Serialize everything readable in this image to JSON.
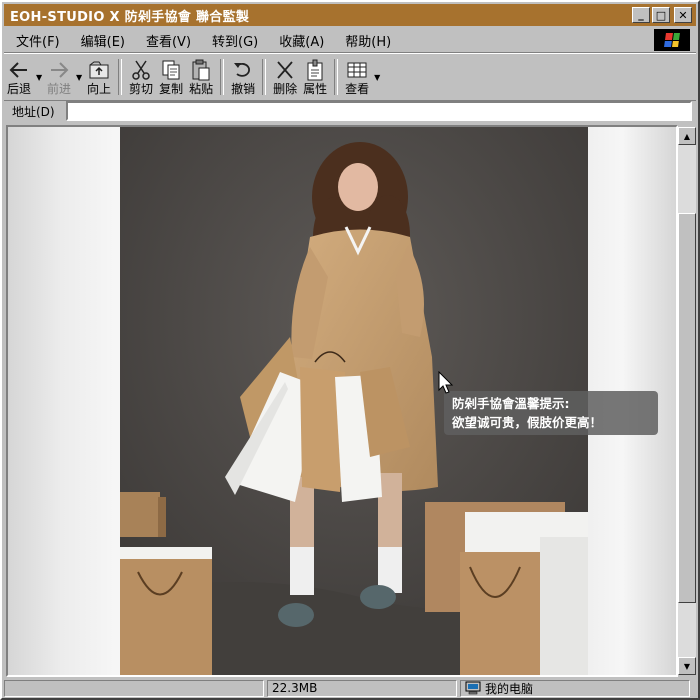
{
  "window": {
    "title": "EOH-STUDIO X 防剁手協會 聯合監製"
  },
  "titlebar_buttons": {
    "minimize": "_",
    "maximize": "□",
    "close": "✕"
  },
  "menu": [
    "文件(F)",
    "编辑(E)",
    "查看(V)",
    "转到(G)",
    "收藏(A)",
    "帮助(H)"
  ],
  "toolbar": {
    "back": "后退",
    "forward": "前进",
    "up": "向上",
    "cut": "剪切",
    "copy": "复制",
    "paste": "粘贴",
    "undo": "撤销",
    "delete": "删除",
    "properties": "属性",
    "view": "查看"
  },
  "address": {
    "label": "地址(D)",
    "value": ""
  },
  "tooltip": {
    "line1": "防剁手協會溫馨提示:",
    "line2": "欲望诚可贵，假肢价更高！"
  },
  "status": {
    "size": "22.3MB",
    "location": "我的电脑"
  },
  "icons": {
    "back": "arrow-left-icon",
    "forward": "arrow-right-icon",
    "up": "folder-up-icon",
    "cut": "scissors-icon",
    "copy": "copy-icon",
    "paste": "paste-icon",
    "undo": "undo-icon",
    "delete": "delete-x-icon",
    "properties": "properties-icon",
    "view": "view-grid-icon",
    "computer": "computer-icon"
  },
  "colors": {
    "titlebar": "#a7722e",
    "chrome": "#c0c0c0",
    "tooltip": "#5f5f5f"
  }
}
